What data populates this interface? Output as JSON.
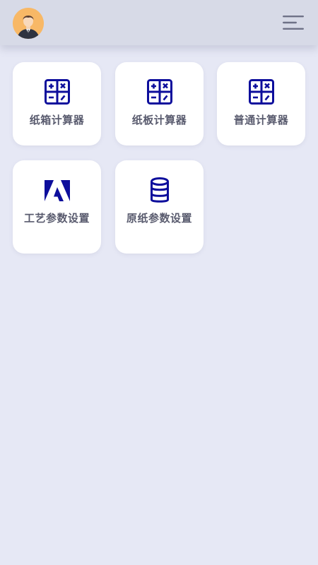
{
  "header": {
    "avatar_icon": "user-avatar-icon",
    "menu_icon": "menu-icon"
  },
  "colors": {
    "background": "#E6E8F5",
    "header": "#D7DAE7",
    "card": "#FFFFFF",
    "icon": "#0D0E9C",
    "label": "#595B6E",
    "avatar_bg": "#F8B866"
  },
  "tiles": [
    {
      "label": "纸箱计算器",
      "icon": "calculator-icon"
    },
    {
      "label": "纸板计算器",
      "icon": "calculator-icon"
    },
    {
      "label": "普通计算器",
      "icon": "calculator-icon"
    },
    {
      "label": "工艺参数设置",
      "icon": "adobe-logo-icon"
    },
    {
      "label": "原纸参数设置",
      "icon": "database-icon"
    }
  ]
}
